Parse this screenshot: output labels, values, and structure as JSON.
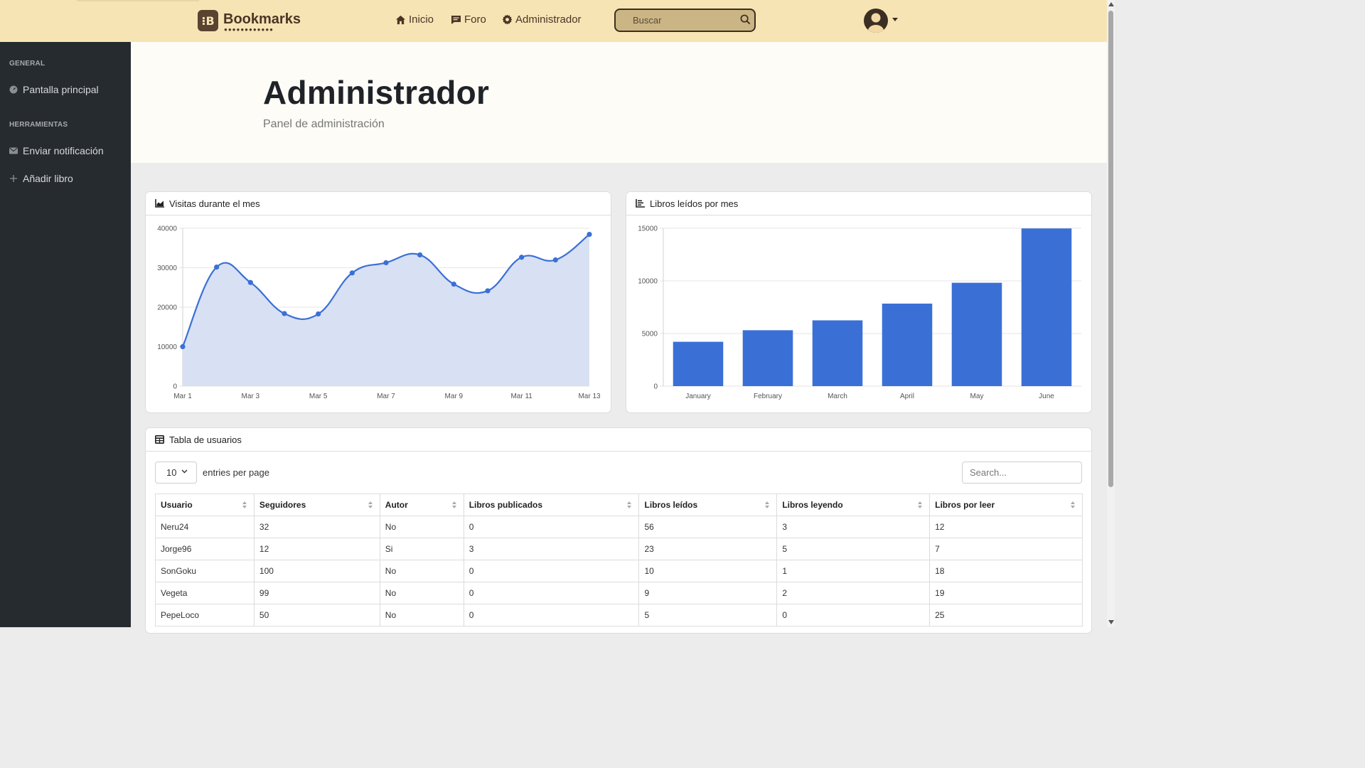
{
  "app": {
    "brand": "Bookmarks",
    "brand_dots": "●●●●●●●●●●●●"
  },
  "nav": {
    "inicio": "Inicio",
    "foro": "Foro",
    "admin": "Administrador",
    "search_placeholder": "Buscar"
  },
  "sidebar": {
    "section_general": "GENERAL",
    "pantalla_principal": "Pantalla principal",
    "section_herramientas": "HERRAMIENTAS",
    "enviar_notificacion": "Enviar notificación",
    "anadir_libro": "Añadir libro"
  },
  "header": {
    "title": "Administrador",
    "subtitle": "Panel de administración"
  },
  "cards": {
    "visitas_title": "Visitas durante el mes",
    "libros_title": "Libros leídos por mes",
    "tabla_title": "Tabla de usuarios"
  },
  "table": {
    "entries_value": "10",
    "entries_label": "entries per page",
    "search_placeholder": "Search...",
    "columns": [
      "Usuario",
      "Seguidores",
      "Autor",
      "Libros publicados",
      "Libros leídos",
      "Libros leyendo",
      "Libros por leer"
    ],
    "rows": [
      [
        "Neru24",
        "32",
        "No",
        "0",
        "56",
        "3",
        "12"
      ],
      [
        "Jorge96",
        "12",
        "Si",
        "3",
        "23",
        "5",
        "7"
      ],
      [
        "SonGoku",
        "100",
        "No",
        "0",
        "10",
        "1",
        "18"
      ],
      [
        "Vegeta",
        "99",
        "No",
        "0",
        "9",
        "2",
        "19"
      ],
      [
        "PepeLoco",
        "50",
        "No",
        "0",
        "5",
        "0",
        "25"
      ]
    ]
  },
  "chart_data": [
    {
      "type": "area",
      "x": [
        "Mar 1",
        "Mar 2",
        "Mar 3",
        "Mar 4",
        "Mar 5",
        "Mar 6",
        "Mar 7",
        "Mar 8",
        "Mar 9",
        "Mar 10",
        "Mar 11",
        "Mar 12",
        "Mar 13"
      ],
      "xticks": [
        "Mar 1",
        "Mar 3",
        "Mar 5",
        "Mar 7",
        "Mar 9",
        "Mar 11",
        "Mar 13"
      ],
      "values": [
        10000,
        30162,
        26263,
        18394,
        18287,
        28682,
        31274,
        33259,
        25849,
        24159,
        32651,
        31984,
        38451
      ],
      "ylim": [
        0,
        40000
      ],
      "yticks": [
        0,
        10000,
        20000,
        30000,
        40000
      ],
      "color": "#3a70d6",
      "fill": "#d8e0f4",
      "grid": true
    },
    {
      "type": "bar",
      "categories": [
        "January",
        "February",
        "March",
        "April",
        "May",
        "June"
      ],
      "values": [
        4215,
        5312,
        6251,
        7841,
        9821,
        14984
      ],
      "ylim": [
        0,
        15000
      ],
      "yticks": [
        0,
        5000,
        10000,
        15000
      ],
      "color": "#3a70d6",
      "grid": true
    }
  ]
}
